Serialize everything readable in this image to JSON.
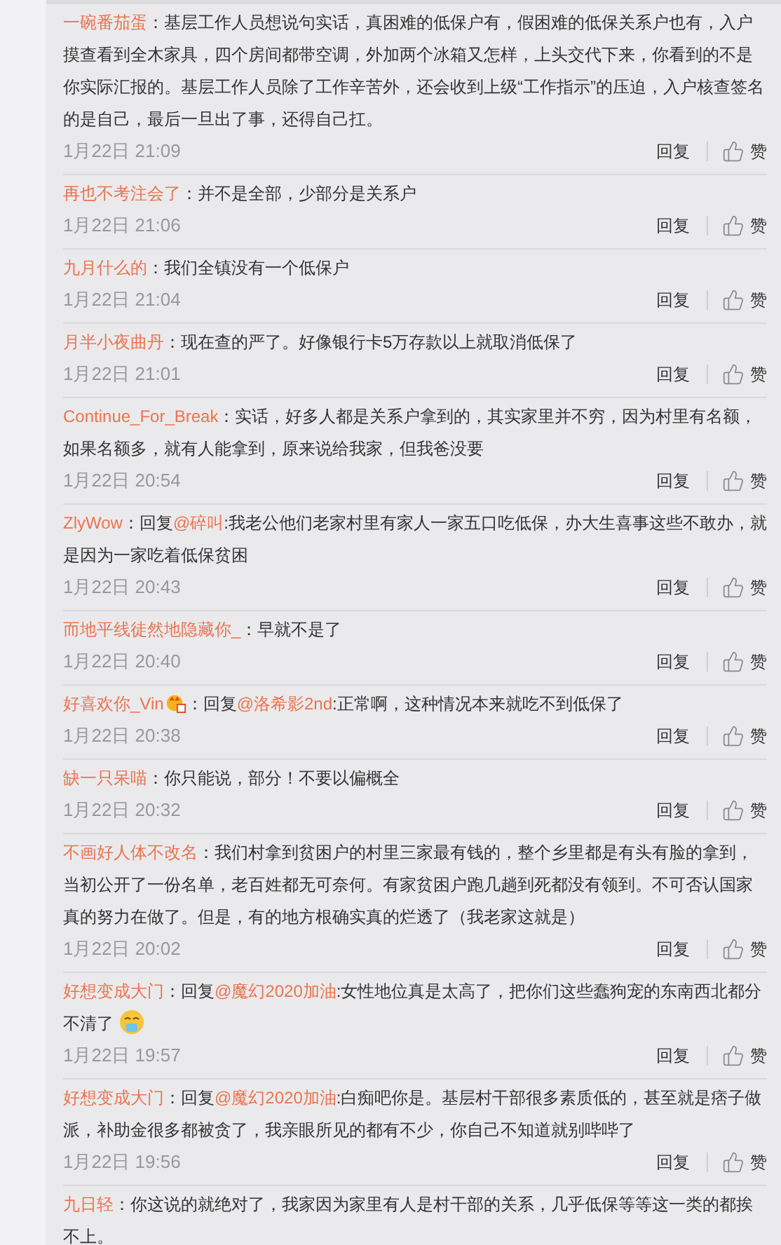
{
  "comments": [
    {
      "user": "一碗番茄蛋",
      "has_badge": false,
      "parts": [
        {
          "kind": "plain",
          "text": "：基层工作人员想说句实话，真困难的低保户有，假困难的低保关系户也有，入户摸查看到全木家具，四个房间都带空调，外加两个冰箱又怎样，上头交代下来，你看到的不是你实际汇报的。基层工作人员除了工作辛苦外，还会收到上级“工作指示”的压迫，入户核查签名的是自己，最后一旦出了事，还得自己扛。"
        }
      ],
      "trailing_emoji": false,
      "meta": {
        "time": "1月22日 21:09",
        "reply": "回复",
        "like": "赞"
      }
    },
    {
      "user": "再也不考注会了",
      "has_badge": false,
      "parts": [
        {
          "kind": "plain",
          "text": "：并不是全部，少部分是关系户"
        }
      ],
      "trailing_emoji": false,
      "meta": {
        "time": "1月22日 21:06",
        "reply": "回复",
        "like": "赞"
      }
    },
    {
      "user": "九月什么的",
      "has_badge": false,
      "parts": [
        {
          "kind": "plain",
          "text": "：我们全镇没有一个低保户"
        }
      ],
      "trailing_emoji": false,
      "meta": {
        "time": "1月22日 21:04",
        "reply": "回复",
        "like": "赞"
      }
    },
    {
      "user": "月半小夜曲丹",
      "has_badge": false,
      "parts": [
        {
          "kind": "plain",
          "text": "：现在查的严了。好像银行卡5万存款以上就取消低保了"
        }
      ],
      "trailing_emoji": false,
      "meta": {
        "time": "1月22日 21:01",
        "reply": "回复",
        "like": "赞"
      }
    },
    {
      "user": "Continue_For_Break",
      "has_badge": false,
      "parts": [
        {
          "kind": "plain",
          "text": "：实话，好多人都是关系户拿到的，其实家里并不穷，因为村里有名额，如果名额多，就有人能拿到，原来说给我家，但我爸没要"
        }
      ],
      "trailing_emoji": false,
      "meta": {
        "time": "1月22日 20:54",
        "reply": "回复",
        "like": "赞"
      }
    },
    {
      "user": "ZlyWow",
      "has_badge": false,
      "parts": [
        {
          "kind": "plain",
          "text": "：回复"
        },
        {
          "kind": "mention",
          "text": "@碎叫"
        },
        {
          "kind": "plain",
          "text": ":我老公他们老家村里有家人一家五口吃低保，办大生喜事这些不敢办，就是因为一家吃着低保贫困"
        }
      ],
      "trailing_emoji": false,
      "meta": {
        "time": "1月22日 20:43",
        "reply": "回复",
        "like": "赞"
      }
    },
    {
      "user": "而地平线徒然地隐藏你_",
      "has_badge": false,
      "parts": [
        {
          "kind": "plain",
          "text": "：早就不是了"
        }
      ],
      "trailing_emoji": false,
      "meta": {
        "time": "1月22日 20:40",
        "reply": "回复",
        "like": "赞"
      }
    },
    {
      "user": "好喜欢你_Vin",
      "has_badge": true,
      "parts": [
        {
          "kind": "plain",
          "text": "：回复"
        },
        {
          "kind": "mention",
          "text": "@洛希影2nd"
        },
        {
          "kind": "plain",
          "text": ":正常啊，这种情况本来就吃不到低保了"
        }
      ],
      "trailing_emoji": false,
      "meta": {
        "time": "1月22日 20:38",
        "reply": "回复",
        "like": "赞"
      }
    },
    {
      "user": "缺一只呆喵",
      "has_badge": false,
      "parts": [
        {
          "kind": "plain",
          "text": "：你只能说，部分！不要以偏概全"
        }
      ],
      "trailing_emoji": false,
      "meta": {
        "time": "1月22日 20:32",
        "reply": "回复",
        "like": "赞"
      }
    },
    {
      "user": "不画好人体不改名",
      "has_badge": false,
      "parts": [
        {
          "kind": "plain",
          "text": "：我们村拿到贫困户的村里三家最有钱的，整个乡里都是有头有脸的拿到，当初公开了一份名单，老百姓都无可奈何。有家贫困户跑几趟到死都没有领到。不可否认国家真的努力在做了。但是，有的地方根确实真的烂透了（我老家这就是）"
        }
      ],
      "trailing_emoji": false,
      "meta": {
        "time": "1月22日 20:02",
        "reply": "回复",
        "like": "赞"
      }
    },
    {
      "user": "好想变成大门",
      "has_badge": false,
      "parts": [
        {
          "kind": "plain",
          "text": "：回复"
        },
        {
          "kind": "mention",
          "text": "@魔幻2020加油"
        },
        {
          "kind": "plain",
          "text": ":女性地位真是太高了，把你们这些蠢狗宠的东南西北都分不清了"
        }
      ],
      "trailing_emoji": true,
      "meta": {
        "time": "1月22日 19:57",
        "reply": "回复",
        "like": "赞"
      }
    },
    {
      "user": "好想变成大门",
      "has_badge": false,
      "parts": [
        {
          "kind": "plain",
          "text": "：回复"
        },
        {
          "kind": "mention",
          "text": "@魔幻2020加油"
        },
        {
          "kind": "plain",
          "text": ":白痴吧你是。基层村干部很多素质低的，甚至就是痞子做派，补助金很多都被贪了，我亲眼所见的都有不少，你自己不知道就别哔哔了"
        }
      ],
      "trailing_emoji": false,
      "meta": {
        "time": "1月22日 19:56",
        "reply": "回复",
        "like": "赞"
      }
    },
    {
      "user": "九日轻",
      "has_badge": false,
      "parts": [
        {
          "kind": "plain",
          "text": "：你这说的就绝对了，我家因为家里有人是村干部的关系，几乎低保等等这一类的都挨不上。"
        }
      ],
      "trailing_emoji": false
    }
  ]
}
